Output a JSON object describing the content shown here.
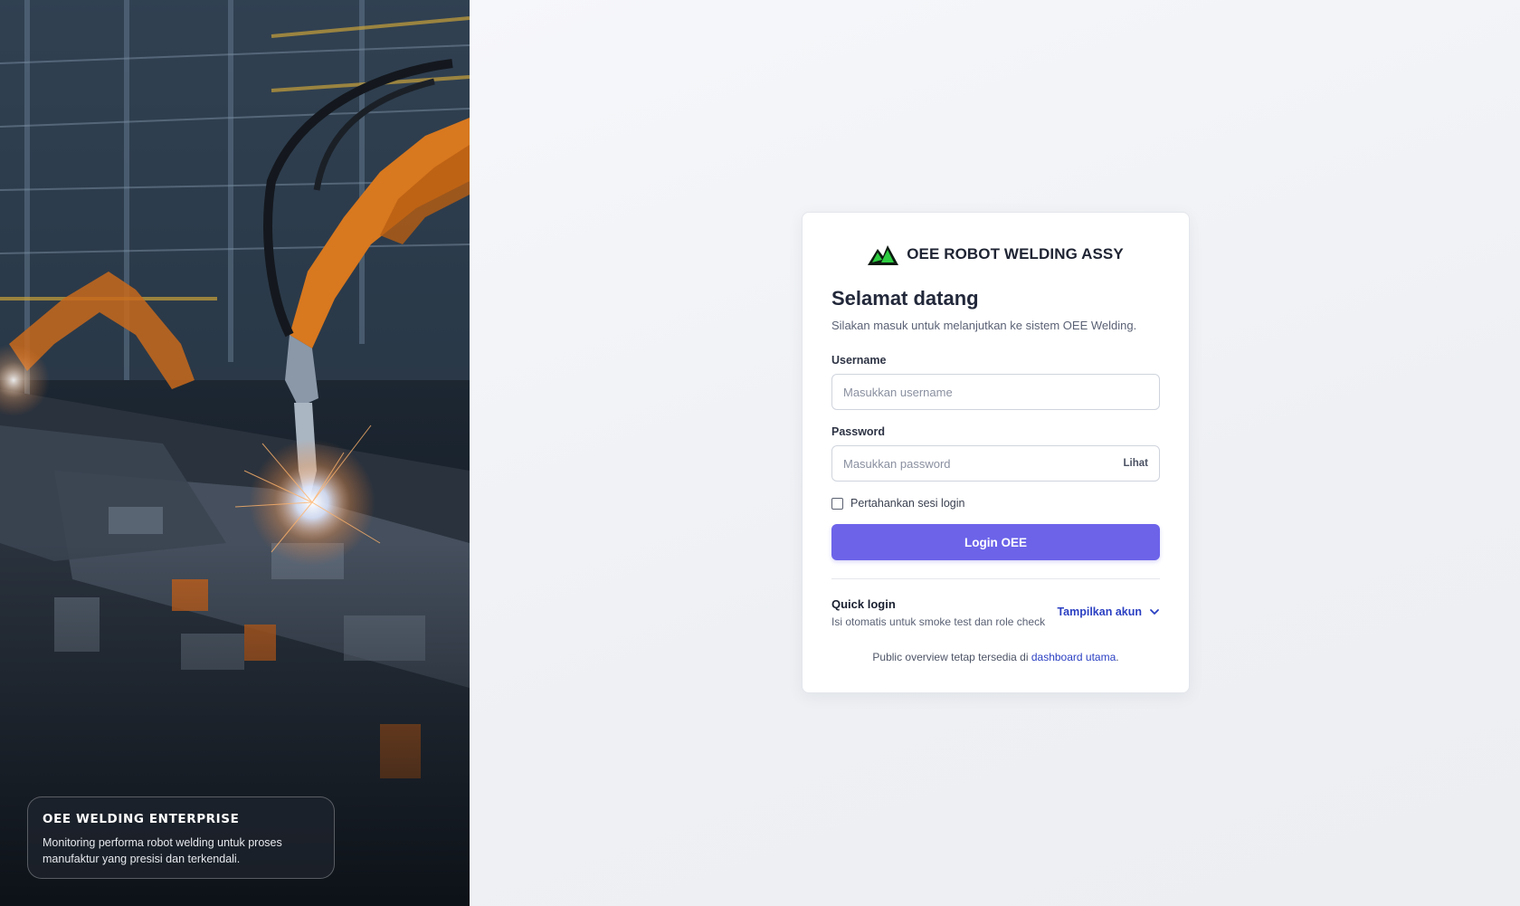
{
  "hero": {
    "card_title": "OEE WELDING ENTERPRISE",
    "card_text": "Monitoring performa robot welding untuk proses manufaktur yang presisi dan terkendali."
  },
  "brand": {
    "name": "OEE ROBOT WELDING ASSY",
    "logo_icon": "mountain-logo-icon"
  },
  "login": {
    "title": "Selamat datang",
    "subtitle": "Silakan masuk untuk melanjutkan ke sistem OEE Welding.",
    "username_label": "Username",
    "username_placeholder": "Masukkan username",
    "username_value": "",
    "password_label": "Password",
    "password_placeholder": "Masukkan password",
    "password_value": "",
    "show_password_label": "Lihat",
    "remember_label": "Pertahankan sesi login",
    "remember_checked": false,
    "submit_label": "Login OEE"
  },
  "quick_login": {
    "title": "Quick login",
    "subtitle": "Isi otomatis untuk smoke test dan role check",
    "toggle_label": "Tampilkan akun",
    "toggle_icon": "chevron-down-icon"
  },
  "footer": {
    "public_text": "Public overview tetap tersedia di ",
    "public_link": "dashboard utama",
    "public_suffix": "."
  },
  "colors": {
    "primary": "#6c63e9",
    "link": "#2a3fc2",
    "logo_green": "#2ecc40"
  }
}
